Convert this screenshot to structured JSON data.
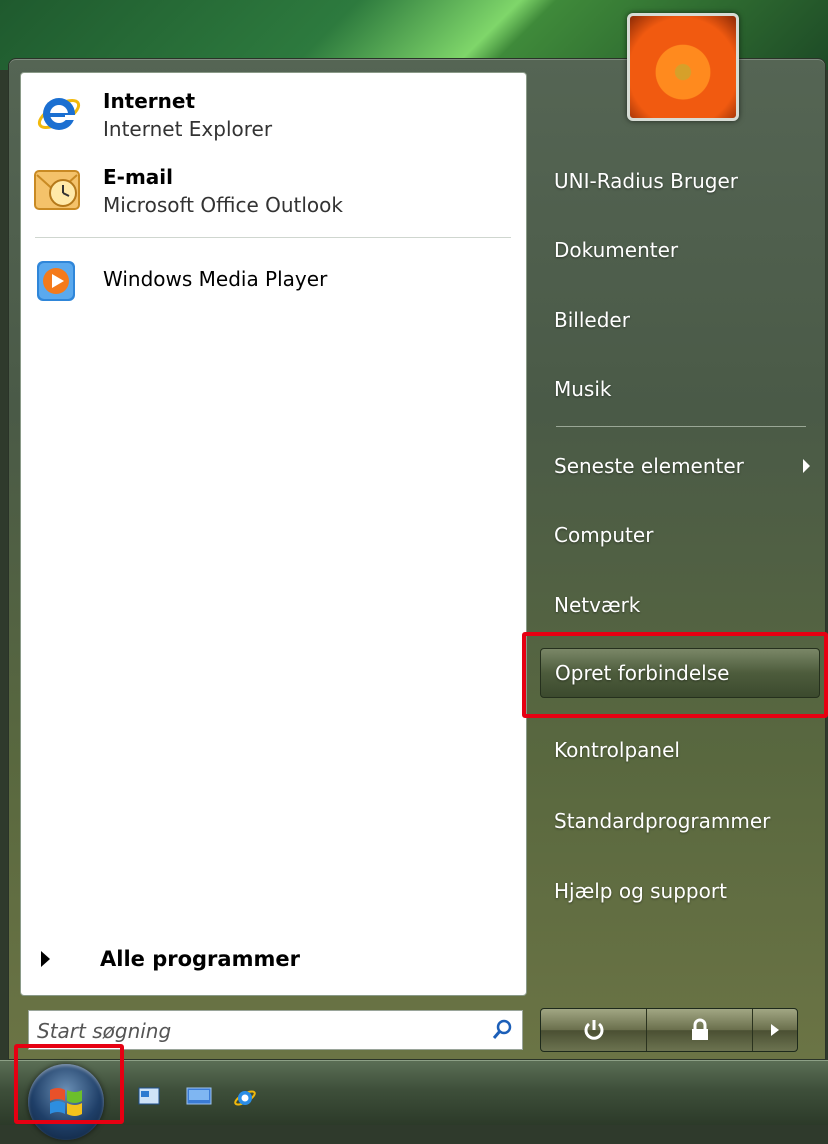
{
  "start_menu": {
    "pinned": [
      {
        "title": "Internet",
        "subtitle": "Internet Explorer",
        "icon": "internet-explorer-icon"
      },
      {
        "title": "E-mail",
        "subtitle": "Microsoft Office Outlook",
        "icon": "outlook-icon"
      }
    ],
    "recent": [
      {
        "label": "Windows Media Player",
        "icon": "windows-media-player-icon"
      }
    ],
    "all_programs_label": "Alle programmer",
    "search": {
      "placeholder": "Start søgning",
      "value": ""
    },
    "right_items": [
      {
        "label": "UNI-Radius Bruger"
      },
      {
        "label": "Dokumenter"
      },
      {
        "label": "Billeder"
      },
      {
        "label": "Musik"
      },
      {
        "label": "Seneste elementer",
        "has_submenu": true
      },
      {
        "label": "Computer"
      },
      {
        "label": "Netværk"
      },
      {
        "label": "Opret forbindelse",
        "highlighted": true
      },
      {
        "label": "Kontrolpanel"
      },
      {
        "label": "Standardprogrammer"
      },
      {
        "label": "Hjælp og support"
      }
    ],
    "power_buttons": [
      "power-icon",
      "lock-icon",
      "arrow-right-icon"
    ]
  },
  "taskbar": {
    "start_button": "windows-orb-icon",
    "quick_launch": [
      "show-desktop-icon",
      "switch-windows-icon",
      "internet-explorer-icon"
    ]
  },
  "colors": {
    "highlight_box": "#e60012",
    "menu_bg": "#4a5a47"
  }
}
